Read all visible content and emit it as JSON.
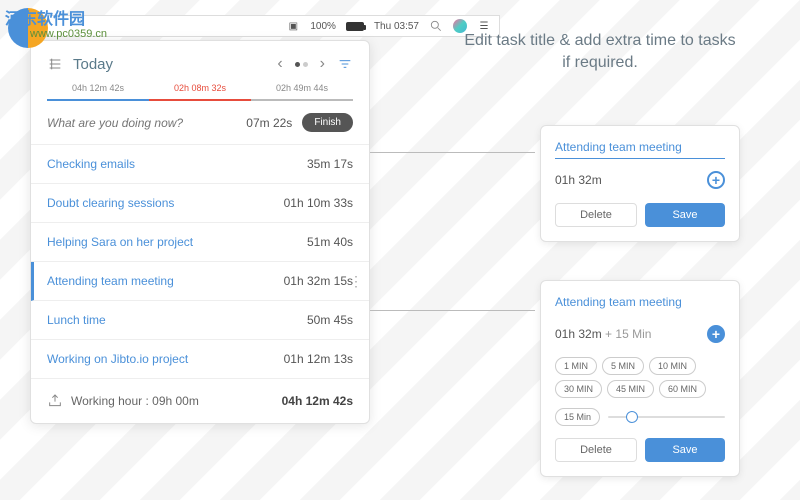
{
  "watermark": {
    "title": "河东软件园",
    "url": "www.pc0359.cn"
  },
  "menubar": {
    "battery_pct": "100%",
    "datetime": "Thu 03:57"
  },
  "headline": "Edit task title & add extra time to tasks if required.",
  "panel": {
    "title": "Today",
    "segments": [
      {
        "label": "04h 12m 42s"
      },
      {
        "label": "02h 08m 32s"
      },
      {
        "label": "02h 49m 44s"
      }
    ],
    "current": {
      "placeholder": "What are you doing now?",
      "elapsed": "07m 22s",
      "finish": "Finish"
    },
    "tasks": [
      {
        "name": "Checking emails",
        "time": "35m 17s"
      },
      {
        "name": "Doubt clearing sessions",
        "time": "01h 10m 33s"
      },
      {
        "name": "Helping Sara on her project",
        "time": "51m 40s"
      },
      {
        "name": "Attending team meeting",
        "time": "01h 32m 15s"
      },
      {
        "name": "Lunch time",
        "time": "50m 45s"
      },
      {
        "name": "Working on Jibto.io project",
        "time": "01h 12m 13s"
      }
    ],
    "footer": {
      "working_label": "Working hour : 09h 00m",
      "total": "04h 12m 42s"
    }
  },
  "card1": {
    "title": "Attending team meeting",
    "time": "01h 32m",
    "delete": "Delete",
    "save": "Save"
  },
  "card2": {
    "title": "Attending team meeting",
    "time": "01h 32m",
    "extra": "+ 15 Min",
    "chips": [
      "1 MIN",
      "5 MIN",
      "10 MIN",
      "30 MIN",
      "45 MIN",
      "60 MIN"
    ],
    "slider_label": "15 Min",
    "delete": "Delete",
    "save": "Save"
  }
}
